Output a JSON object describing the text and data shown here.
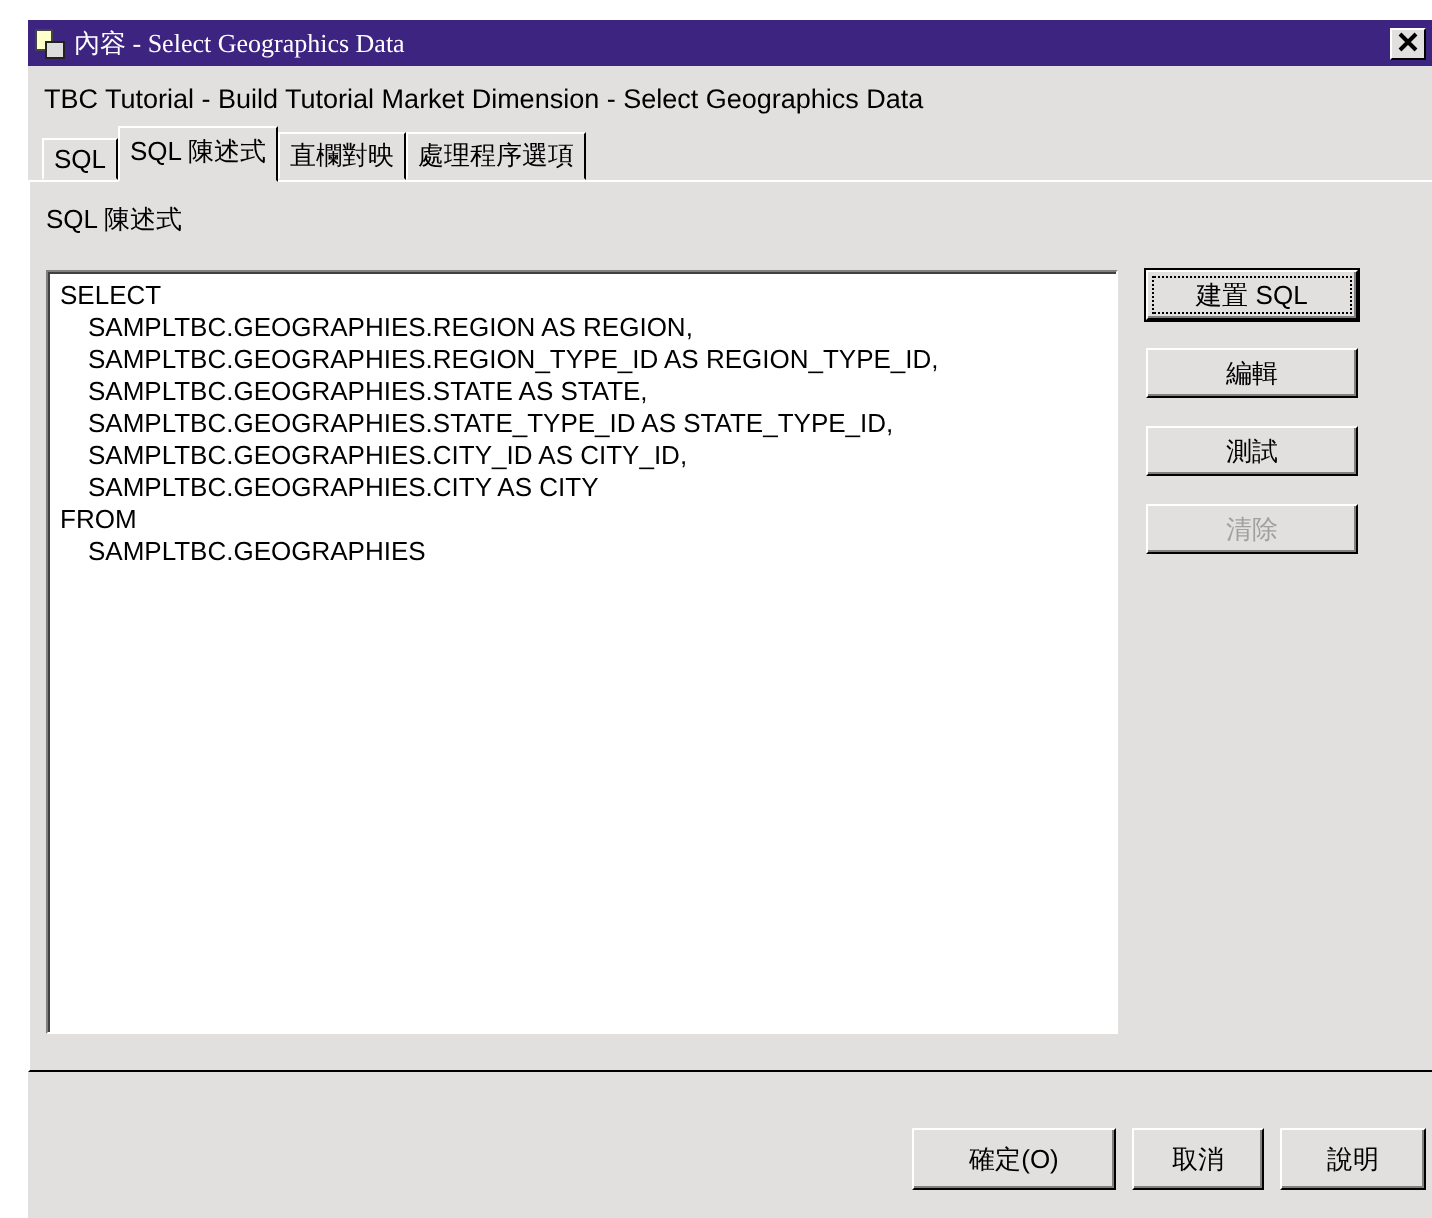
{
  "window": {
    "title": "內容 - Select Geographics Data"
  },
  "subtitle": "TBC Tutorial - Build Tutorial Market Dimension - Select Geographics Data",
  "tabs": [
    {
      "label": "SQL",
      "selected": false
    },
    {
      "label": "SQL 陳述式",
      "selected": true
    },
    {
      "label": "直欄對映",
      "selected": false
    },
    {
      "label": "處理程序選項",
      "selected": false
    }
  ],
  "panel_label": "SQL 陳述式",
  "sql": [
    {
      "keyword": "SELECT",
      "lines": [
        "SAMPLTBC.GEOGRAPHIES.REGION AS REGION,",
        "SAMPLTBC.GEOGRAPHIES.REGION_TYPE_ID AS REGION_TYPE_ID,",
        "SAMPLTBC.GEOGRAPHIES.STATE AS STATE,",
        "SAMPLTBC.GEOGRAPHIES.STATE_TYPE_ID AS STATE_TYPE_ID,",
        "SAMPLTBC.GEOGRAPHIES.CITY_ID AS CITY_ID,",
        "SAMPLTBC.GEOGRAPHIES.CITY AS CITY"
      ]
    },
    {
      "keyword": "FROM",
      "lines": [
        "SAMPLTBC.GEOGRAPHIES"
      ]
    }
  ],
  "side_buttons": [
    {
      "label": "建置 SQL",
      "disabled": false,
      "focused": true
    },
    {
      "label": "編輯",
      "disabled": false,
      "focused": false
    },
    {
      "label": "測試",
      "disabled": false,
      "focused": false
    },
    {
      "label": "清除",
      "disabled": true,
      "focused": false
    }
  ],
  "footer_buttons": [
    "確定(O)",
    "取消",
    "說明"
  ]
}
